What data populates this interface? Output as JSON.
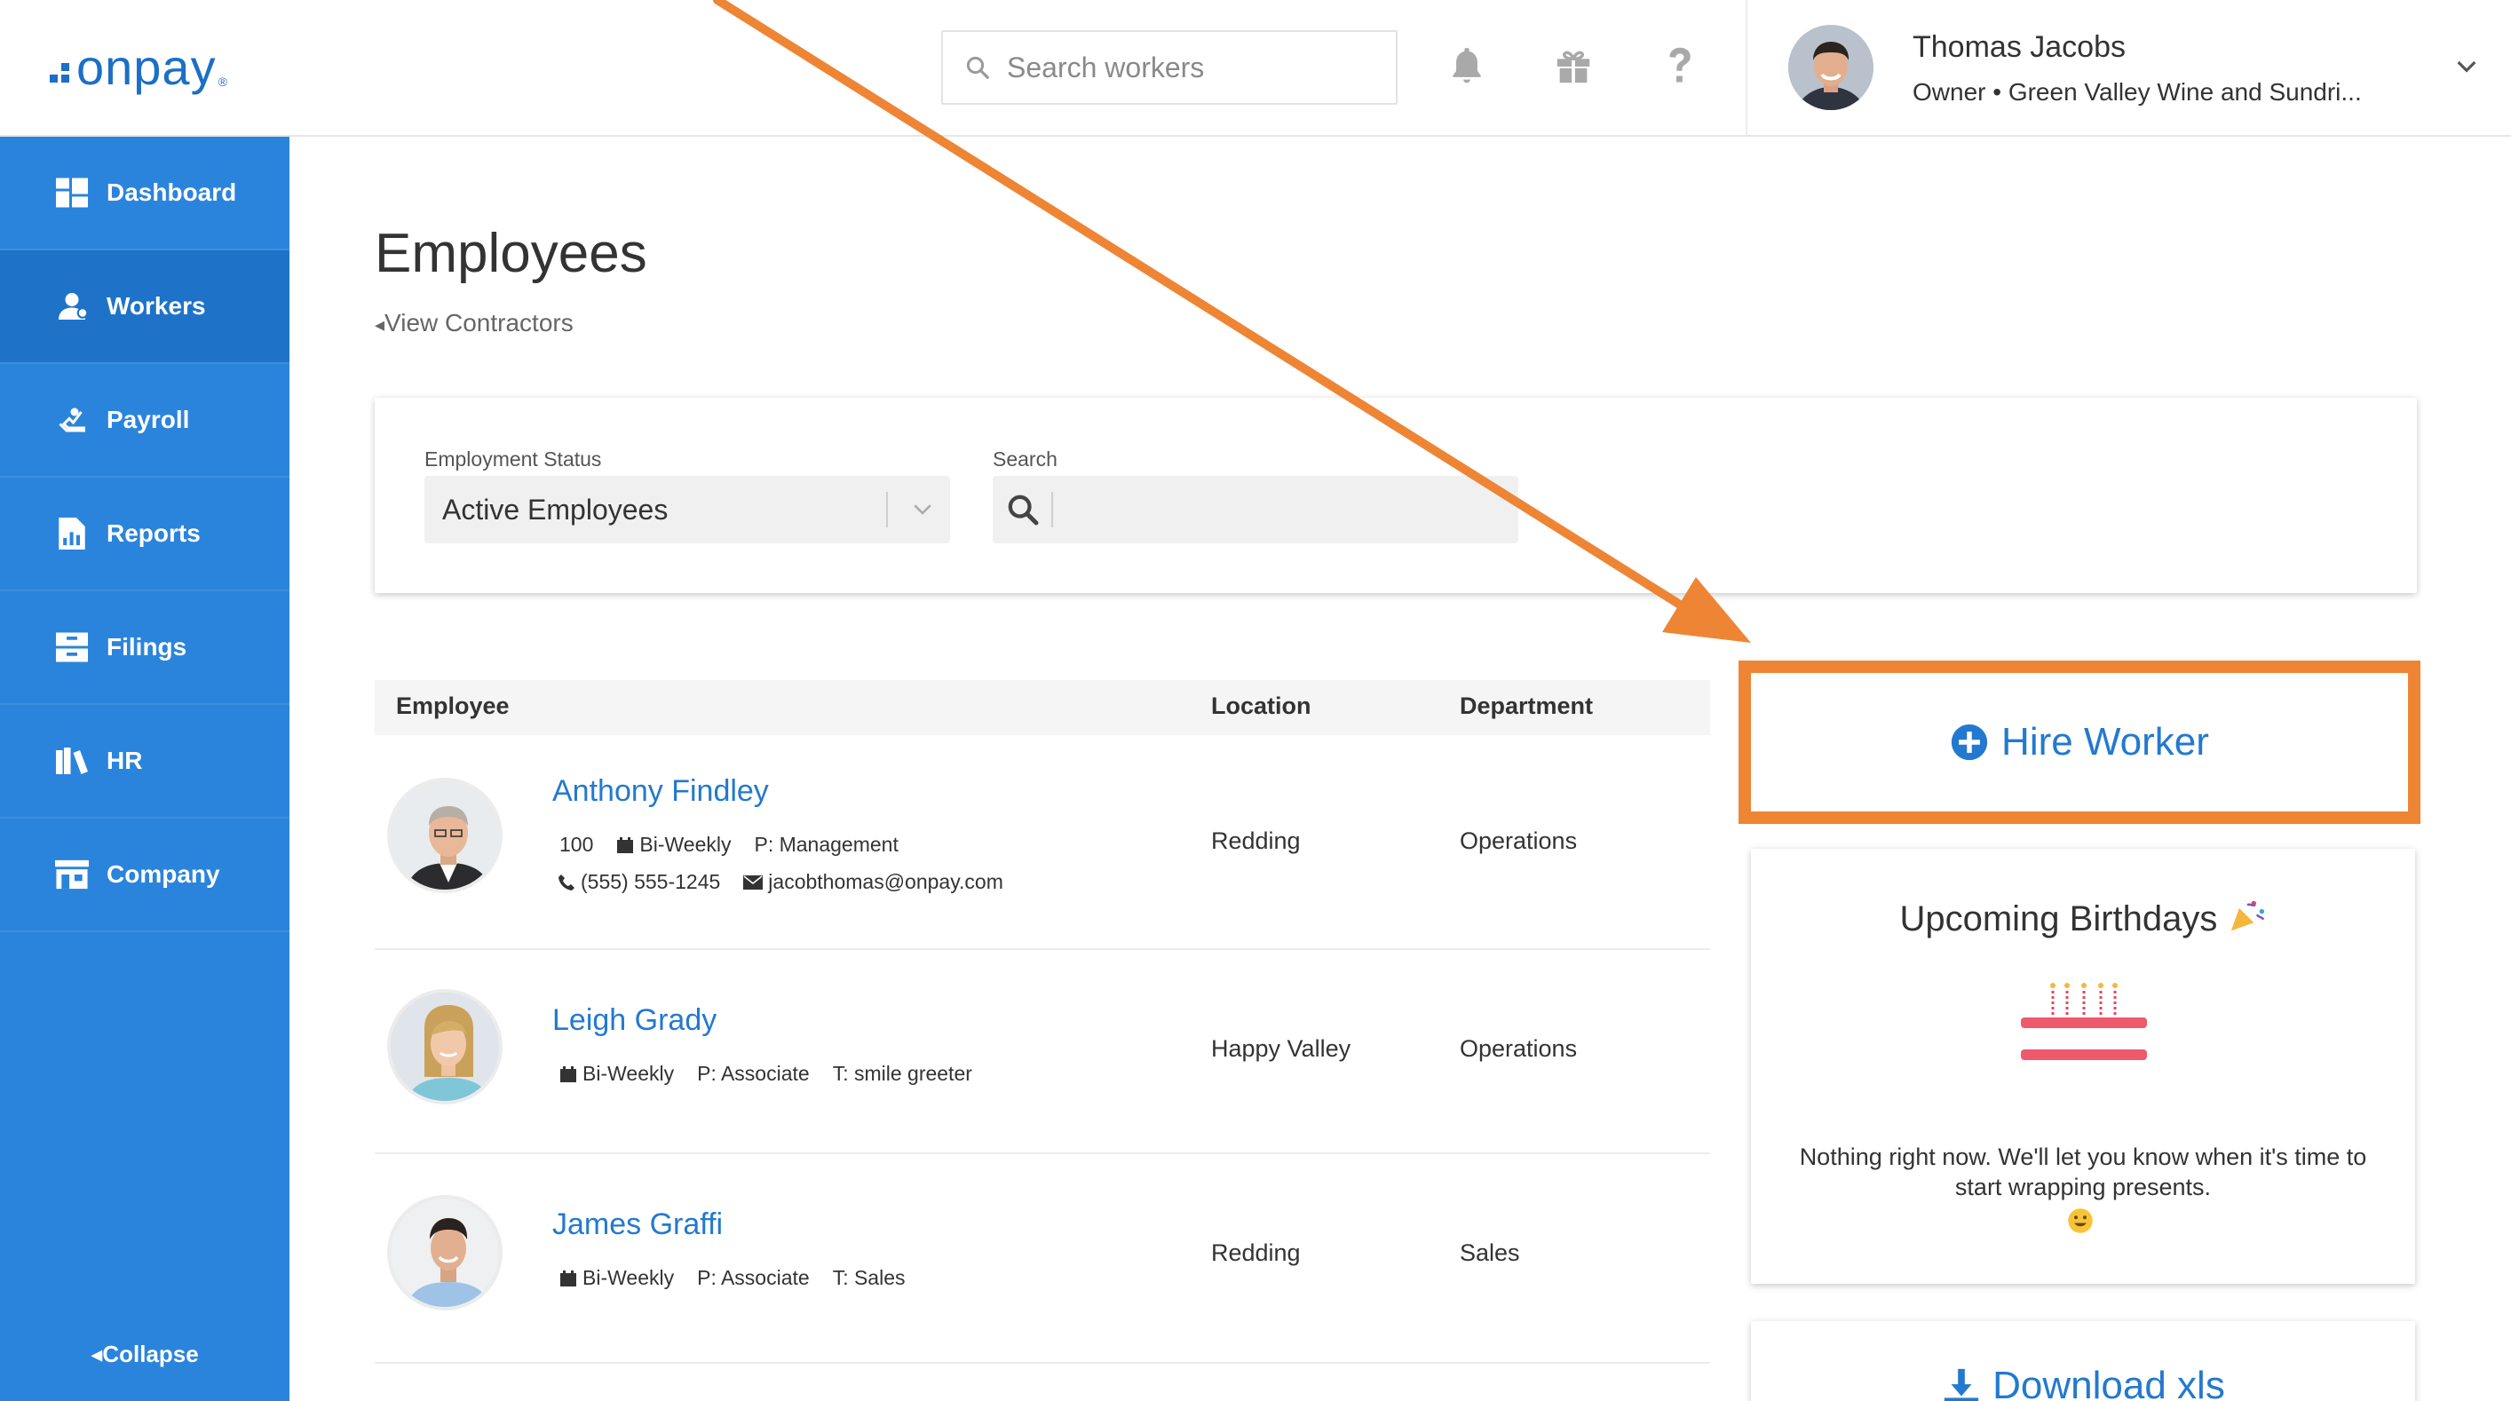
{
  "app": {
    "logo_text": "onpay",
    "logo_reg": "®"
  },
  "topbar": {
    "search_placeholder": "Search workers",
    "icons": [
      "bell-icon",
      "gift-icon",
      "help-icon"
    ],
    "user_name": "Thomas Jacobs",
    "user_role": "Owner • Green Valley Wine and Sundri..."
  },
  "sidebar": {
    "items": [
      {
        "label": "Dashboard",
        "icon": "dashboard-icon"
      },
      {
        "label": "Workers",
        "icon": "workers-icon",
        "active": true
      },
      {
        "label": "Payroll",
        "icon": "payroll-icon"
      },
      {
        "label": "Reports",
        "icon": "reports-icon"
      },
      {
        "label": "Filings",
        "icon": "filings-icon"
      },
      {
        "label": "HR",
        "icon": "hr-icon"
      },
      {
        "label": "Company",
        "icon": "company-icon"
      }
    ],
    "collapse_label": "Collapse"
  },
  "main": {
    "title": "Employees",
    "view_contractors": "View Contractors",
    "filters": {
      "status_label": "Employment Status",
      "status_value": "Active Employees",
      "search_label": "Search"
    },
    "table": {
      "headers": {
        "employee": "Employee",
        "location": "Location",
        "department": "Department"
      },
      "rows": [
        {
          "name": "Anthony Findley",
          "id": "100",
          "schedule": "Bi-Weekly",
          "position": "P: Management",
          "phone": "(555) 555-1245",
          "email": "jacobthomas@onpay.com",
          "location": "Redding",
          "department": "Operations"
        },
        {
          "name": "Leigh Grady",
          "schedule": "Bi-Weekly",
          "position": "P: Associate",
          "title": "T: smile greeter",
          "location": "Happy Valley",
          "department": "Operations"
        },
        {
          "name": "James Graffi",
          "schedule": "Bi-Weekly",
          "position": "P: Associate",
          "title": "T: Sales",
          "location": "Redding",
          "department": "Sales"
        }
      ]
    }
  },
  "right": {
    "hire_label": "Hire Worker",
    "birthdays_title": "Upcoming Birthdays",
    "birthdays_msg": "Nothing right now. We'll let you know when it's time to start wrapping presents.",
    "download_label": "Download xls"
  },
  "colors": {
    "brand_blue": "#2379cf",
    "sidebar_blue": "#2b84dc",
    "sidebar_active": "#1e73c9",
    "annotation_orange": "#ee8535"
  }
}
